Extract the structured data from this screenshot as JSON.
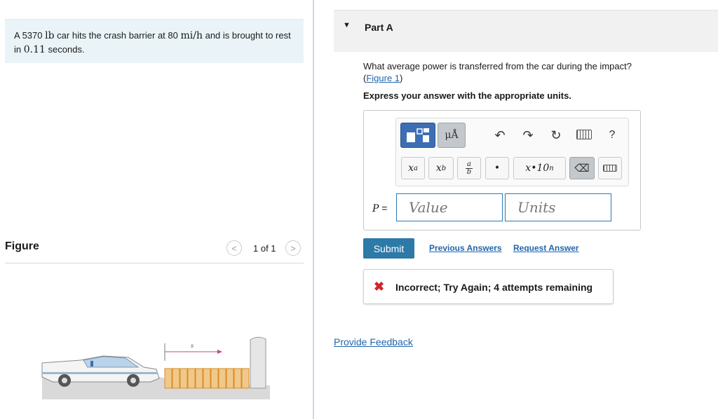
{
  "problem": {
    "text_before_weight": "A 5370 ",
    "weight_unit": "lb",
    "text_mid1": " car hits the crash barrier at 80 ",
    "speed_unit": "mi/h",
    "text_mid2": " and is brought to rest in ",
    "time_value": "0.11",
    "text_end": " seconds."
  },
  "figure": {
    "title": "Figure",
    "pager": "1 of 1",
    "prev_icon": "chevron-left-icon",
    "next_icon": "chevron-right-icon",
    "label_s": "s"
  },
  "part": {
    "caret": "▼",
    "title": "Part A"
  },
  "question": {
    "text": "What average power is transferred from the car during the impact?",
    "link_open": "(",
    "link": "Figure 1",
    "link_close": ")"
  },
  "instruction": "Express your answer with the appropriate units.",
  "toolbar": {
    "units_button": "μÅ",
    "undo_icon": "↶",
    "redo_icon": "↷",
    "reset_icon": "↻",
    "keyboard_icon": "keyboard-icon",
    "help": "?",
    "superscript_base": "x",
    "superscript_exp": "a",
    "subscript_base": "x",
    "subscript_sub": "b",
    "fraction_num": "a",
    "fraction_den": "b",
    "dot": "•",
    "sci_base": "x",
    "sci_mid": "•10",
    "sci_exp": "n",
    "backspace_icon": "⌫"
  },
  "answer": {
    "variable": "P",
    "equals": " =",
    "value_placeholder": "Value",
    "units_placeholder": "Units"
  },
  "actions": {
    "submit": "Submit",
    "previous_answers": "Previous Answers",
    "request_answer": "Request Answer"
  },
  "feedback": {
    "icon": "✖",
    "text": "Incorrect; Try Again; 4 attempts remaining"
  },
  "provide_feedback": "Provide Feedback",
  "colors": {
    "accent": "#2d79a7",
    "link": "#2166ab",
    "error": "#d0252a",
    "problem_bg": "#eaf4f8"
  }
}
